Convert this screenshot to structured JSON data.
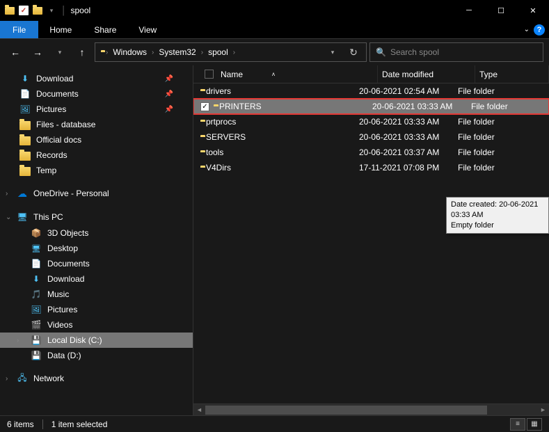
{
  "window": {
    "title": "spool"
  },
  "ribbon": {
    "file": "File",
    "tabs": [
      "Home",
      "Share",
      "View"
    ]
  },
  "breadcrumbs": [
    "Windows",
    "System32",
    "spool"
  ],
  "search": {
    "placeholder": "Search spool"
  },
  "nav_quick": [
    {
      "label": "Download",
      "icon": "download",
      "pinned": true
    },
    {
      "label": "Documents",
      "icon": "doc",
      "pinned": true
    },
    {
      "label": "Pictures",
      "icon": "pic",
      "pinned": true
    },
    {
      "label": "Files - database",
      "icon": "folder",
      "pinned": false
    },
    {
      "label": "Official docs",
      "icon": "folder",
      "pinned": false
    },
    {
      "label": "Records",
      "icon": "folder",
      "pinned": false
    },
    {
      "label": "Temp",
      "icon": "folder",
      "pinned": false
    }
  ],
  "nav_onedrive": {
    "label": "OneDrive - Personal"
  },
  "nav_thispc": {
    "label": "This PC",
    "children": [
      {
        "label": "3D Objects",
        "icon": "3d"
      },
      {
        "label": "Desktop",
        "icon": "desktop"
      },
      {
        "label": "Documents",
        "icon": "doc"
      },
      {
        "label": "Download",
        "icon": "download"
      },
      {
        "label": "Music",
        "icon": "music"
      },
      {
        "label": "Pictures",
        "icon": "pic"
      },
      {
        "label": "Videos",
        "icon": "video"
      },
      {
        "label": "Local Disk (C:)",
        "icon": "disk",
        "selected": true
      },
      {
        "label": "Data (D:)",
        "icon": "disk"
      }
    ]
  },
  "nav_network": {
    "label": "Network"
  },
  "columns": {
    "name": "Name",
    "date": "Date modified",
    "type": "Type"
  },
  "files": [
    {
      "name": "drivers",
      "date": "20-06-2021 02:54 AM",
      "type": "File folder",
      "selected": false
    },
    {
      "name": "PRINTERS",
      "date": "20-06-2021 03:33 AM",
      "type": "File folder",
      "selected": true
    },
    {
      "name": "prtprocs",
      "date": "20-06-2021 03:33 AM",
      "type": "File folder",
      "selected": false
    },
    {
      "name": "SERVERS",
      "date": "20-06-2021 03:33 AM",
      "type": "File folder",
      "selected": false
    },
    {
      "name": "tools",
      "date": "20-06-2021 03:37 AM",
      "type": "File folder",
      "selected": false
    },
    {
      "name": "V4Dirs",
      "date": "17-11-2021 07:08 PM",
      "type": "File folder",
      "selected": false
    }
  ],
  "tooltip": {
    "line1": "Date created: 20-06-2021 03:33 AM",
    "line2": "Empty folder"
  },
  "status": {
    "count": "6 items",
    "selected": "1 item selected"
  }
}
